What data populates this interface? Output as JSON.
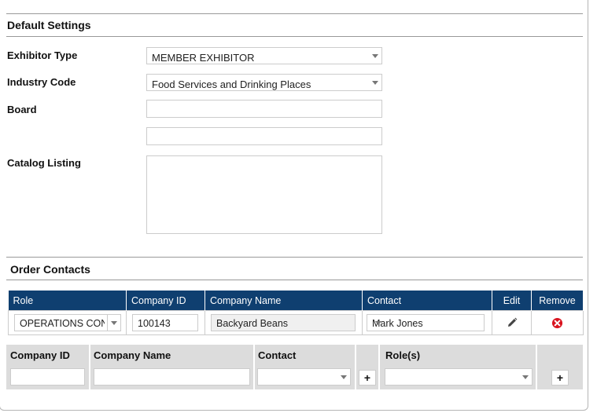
{
  "default_settings": {
    "title": "Default Settings",
    "exhibitor_type": {
      "label": "Exhibitor Type",
      "value": "MEMBER EXHIBITOR"
    },
    "industry_code": {
      "label": "Industry Code",
      "value": "Food Services and Drinking Places"
    },
    "board": {
      "label": "Board",
      "value1": "",
      "value2": ""
    },
    "catalog_listing": {
      "label": "Catalog Listing",
      "value": ""
    }
  },
  "order_contacts": {
    "title": "Order Contacts",
    "columns": [
      "Role",
      "Company ID",
      "Company Name",
      "Contact",
      "Edit",
      "Remove"
    ],
    "rows": [
      {
        "role": "OPERATIONS CONTACT",
        "company_id": "100143",
        "company_name": "Backyard Beans",
        "contact": "Mark Jones"
      }
    ],
    "add_form": {
      "company_id_label": "Company ID",
      "company_name_label": "Company Name",
      "contact_label": "Contact",
      "roles_label": "Role(s)",
      "plus_label": "+"
    }
  },
  "icons": {
    "edit": "pencil-icon",
    "remove": "remove-x-icon",
    "remove_color": "#d9141f"
  },
  "colors": {
    "table_header": "#0f3f70"
  }
}
